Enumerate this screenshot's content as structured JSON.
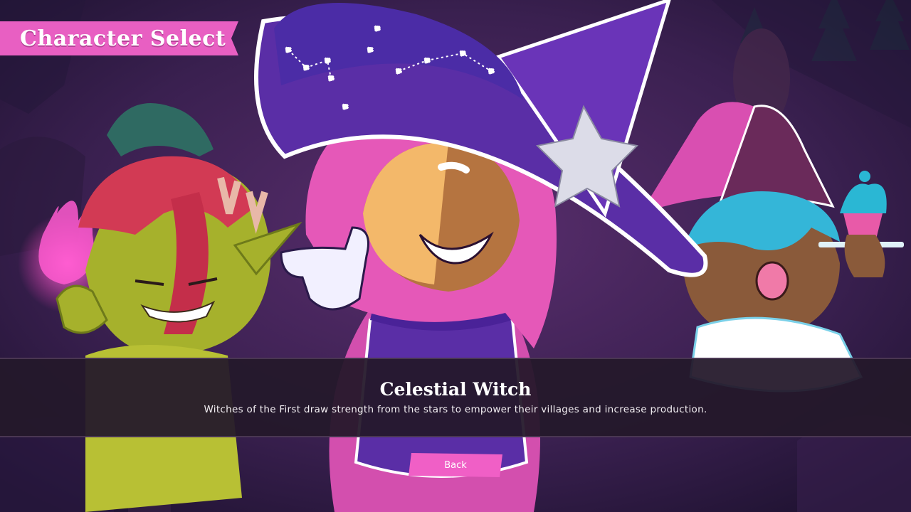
{
  "screen": {
    "title": "Character Select"
  },
  "selected_character": {
    "name": "Celestial Witch",
    "description": "Witches of the First draw strength from the stars to empower their villages and increase production."
  },
  "buttons": {
    "back_label": "Back"
  },
  "characters": [
    {
      "name": "goblin-character"
    },
    {
      "name": "celestial-witch-character"
    },
    {
      "name": "baker-witch-character"
    }
  ],
  "colors": {
    "accent_pink": "#e85fc2",
    "info_bar": "#24182a",
    "hat_purple": "#5a2ea6",
    "hair_pink": "#e558b8"
  }
}
